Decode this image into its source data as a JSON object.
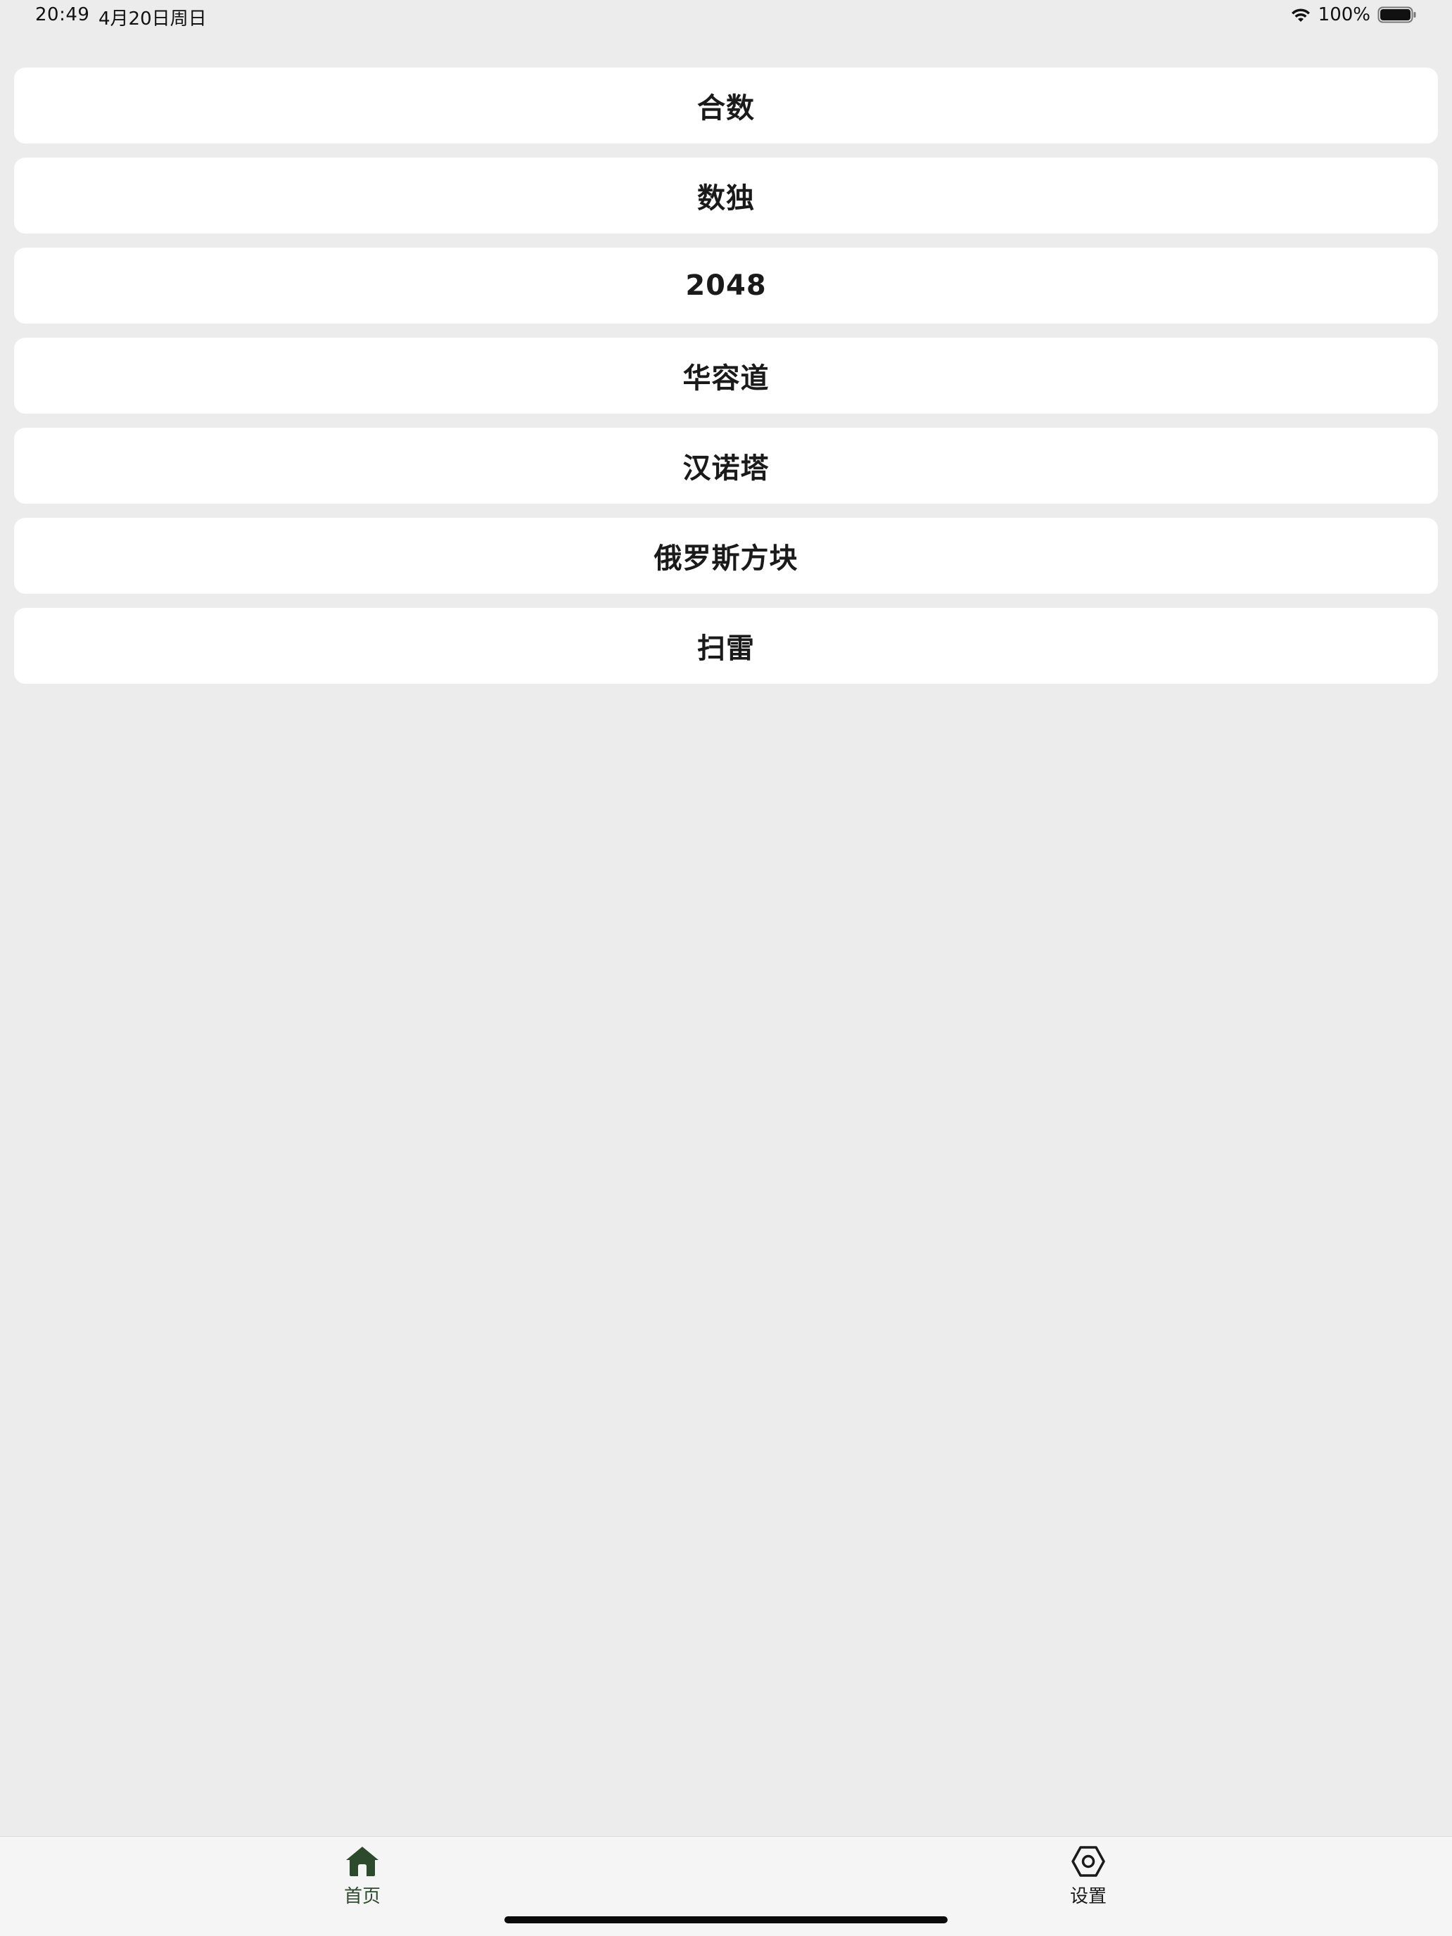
{
  "status_bar": {
    "time": "20:49",
    "date": "4月20日周日",
    "battery_percent": "100%",
    "battery_level": 1.0,
    "icons": [
      "wifi-icon",
      "battery-icon"
    ]
  },
  "games": [
    {
      "label": "合数"
    },
    {
      "label": "数独"
    },
    {
      "label": "2048"
    },
    {
      "label": "华容道"
    },
    {
      "label": "汉诺塔"
    },
    {
      "label": "俄罗斯方块"
    },
    {
      "label": "扫雷"
    }
  ],
  "tab_bar": {
    "tabs": [
      {
        "label": "首页",
        "icon": "home-icon",
        "active": true
      },
      {
        "label": "设置",
        "icon": "settings-icon",
        "active": false
      }
    ]
  },
  "colors": {
    "background": "#ececec",
    "card": "#ffffff",
    "active_tab": "#2e4a2c",
    "inactive_tab": "#1a1a1a"
  }
}
